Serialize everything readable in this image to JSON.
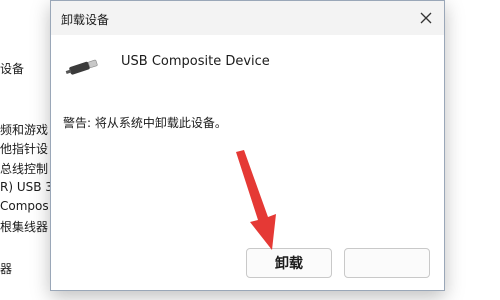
{
  "background_list": {
    "items": [
      "设备",
      "频和游戏",
      "他指针设",
      "总线控制",
      "R) USB 3",
      "Compos",
      "根集线器",
      "器"
    ]
  },
  "dialog": {
    "title": "卸载设备",
    "device_name": "USB Composite Device",
    "warning_text": "警告: 将从系统中卸载此设备。",
    "buttons": {
      "uninstall": "卸载",
      "cancel": ""
    }
  },
  "icons": {
    "close": "close-icon",
    "device": "usb-device-icon"
  },
  "colors": {
    "annotation": "#e53935",
    "dialog_border": "#9aa7b8"
  }
}
